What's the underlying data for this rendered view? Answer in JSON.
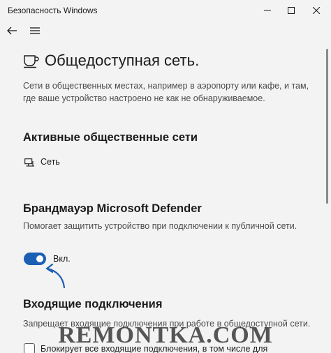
{
  "window": {
    "app_title": "Безопасность Windows"
  },
  "page": {
    "title": "Общедоступная сеть.",
    "description": "Сети в общественных местах, например в аэропорту или кафе, и там, где ваше устройство настроено не как не обнаруживаемое."
  },
  "active_networks": {
    "heading": "Активные общественные сети",
    "network_label": "Сеть"
  },
  "firewall": {
    "heading": "Брандмауэр Microsoft Defender",
    "description": "Помогает защитить устройство при подключении к публичной сети.",
    "toggle_label": "Вкл.",
    "toggle_on": true
  },
  "incoming": {
    "heading": "Входящие подключения",
    "description": "Запрещает входящие подключения при работе в общедоступной сети.",
    "checkbox_label": "Блокирует все входящие подключения, в том числе для",
    "checkbox_checked": false
  },
  "watermark": "REMONTKA.COM",
  "colors": {
    "accent": "#1a5fb4",
    "background": "#f3f3f3"
  },
  "icons": {
    "back": "arrow-left-icon",
    "menu": "hamburger-icon",
    "page": "coffee-cup-icon",
    "network": "monitor-network-icon",
    "minimize": "minimize-icon",
    "maximize": "maximize-icon",
    "close": "close-icon"
  }
}
